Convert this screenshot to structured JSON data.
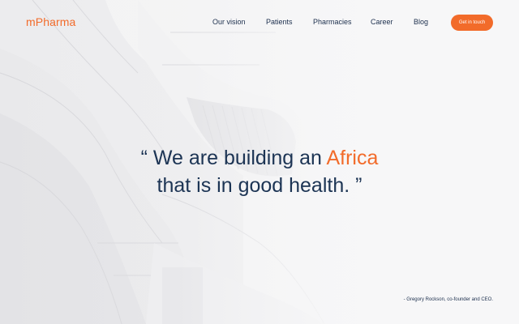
{
  "brand": {
    "name": "mPharma",
    "accent_color": "#f26b2a",
    "text_color": "#1c3454"
  },
  "nav": {
    "items": [
      {
        "label": "Our vision"
      },
      {
        "label": "Patients"
      },
      {
        "label": "Pharmacies"
      },
      {
        "label": "Career"
      },
      {
        "label": "Blog"
      }
    ],
    "cta_label": "Get in touch"
  },
  "hero": {
    "quote_open": "“ We are building an ",
    "quote_highlight": "Africa",
    "quote_line2": "that is in good health. ”",
    "attribution": "- Gregory Rockson, co-founder and CEO.",
    "background_image": "white-architecture"
  }
}
